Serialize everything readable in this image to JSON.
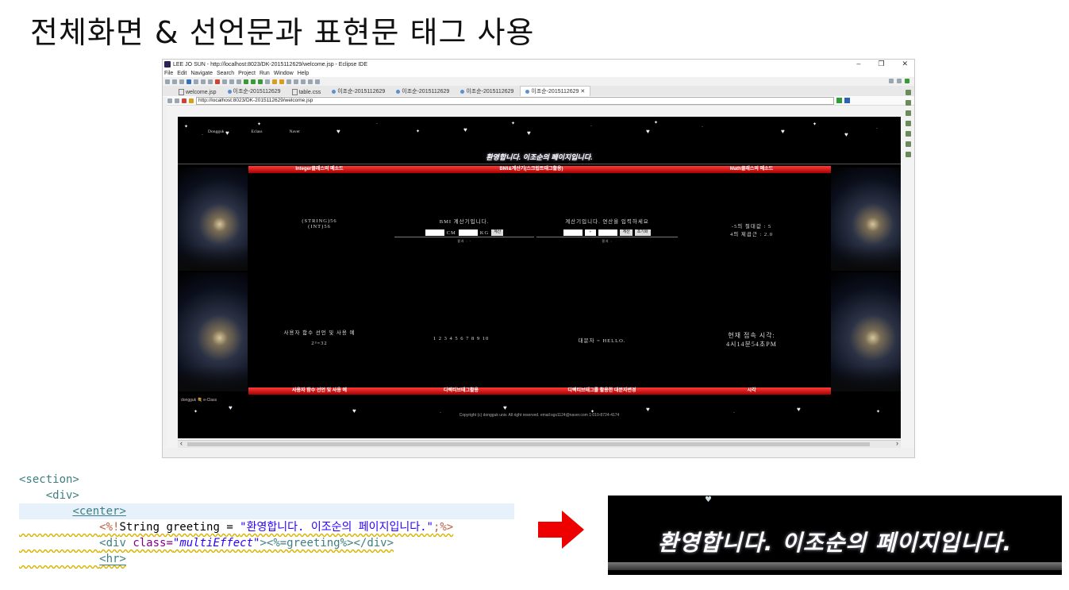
{
  "slide": {
    "title": "전체화면 & 선언문과 표현문 태그 사용"
  },
  "eclipse": {
    "window_title": "LEE JO SUN - http://localhost:8023/DK-2015112629/welcome.jsp - Eclipse IDE",
    "window_controls": {
      "minimize": "–",
      "maximize": "❐",
      "close": "✕"
    },
    "menu": [
      "File",
      "Edit",
      "Navigate",
      "Search",
      "Project",
      "Run",
      "Window",
      "Help"
    ],
    "tabs": [
      {
        "label": "welcome.jsp",
        "icon": "file-icon"
      },
      {
        "label": "이조순-2015112629",
        "icon": "globe-icon"
      },
      {
        "label": "table.css",
        "icon": "file-icon"
      },
      {
        "label": "이조순-2015112629",
        "icon": "globe-icon"
      },
      {
        "label": "이조순-2015112629",
        "icon": "globe-icon"
      },
      {
        "label": "이조순-2015112629",
        "icon": "globe-icon"
      },
      {
        "label": "이조순-2015112629 ✕",
        "icon": "globe-icon",
        "active": true
      }
    ],
    "url": "http://localhost:8023/DK-2015112629/welcome.jsp"
  },
  "page": {
    "nav": [
      "Dongguk",
      "Eclass",
      "Naver"
    ],
    "greeting": "환영합니다. 이조순의 페이지입니다.",
    "headers": [
      "Integer클래스의 메소드",
      "BMI&계산기(스크립트태그활용)",
      "Math클래스의 메소드"
    ],
    "footers": [
      "사용자 함수 선언 및 사용 예",
      "디렉티브태그활용",
      "디렉티브태그를 활용한 대문자변경",
      "시각"
    ],
    "integer_cell": {
      "line1": "(STRING)56",
      "line2": "(INT)56"
    },
    "bmi": {
      "title": "BMI 계산기입니다.",
      "cm": "CM",
      "kg": "KG",
      "button": "계산",
      "result": "결과 : -"
    },
    "calc": {
      "title": "계산기입니다. 연산을 입력하세요",
      "op": "+",
      "button1": "계산",
      "button2": "초기화",
      "result": "결과 :"
    },
    "math_cell": {
      "line1": "-5의 절대값 : 5",
      "line2": "4의 제곱근 : 2.0"
    },
    "func_cell": {
      "line1": "사용자 함수 선언 및 사용 예",
      "line2": "2³=32"
    },
    "numbers": "1 2 3 4 5 6 7 8 9 10",
    "upper": "대문자 = HELLO.",
    "time": {
      "line1": "현재 접속 시각:",
      "line2": "4시14분54초PM"
    },
    "copyright": "Copyright (c) dongguk univ. All right reserved.    email:sgs1124@naver.com 1:010-8724-4174",
    "logo": "dongguk 💐 e-Class"
  },
  "code": {
    "lines": [
      {
        "indent": "",
        "text": "<section>"
      },
      {
        "indent": "    ",
        "text": "<div>"
      },
      {
        "indent": "        ",
        "text": "<center>"
      },
      {
        "indent": "            ",
        "pre": "<%!",
        "kw": "String greeting = ",
        "str": "\"환영합니다. 이조순의 페이지입니다.\"",
        "post": ";%>"
      },
      {
        "indent": "            ",
        "tag": "<div ",
        "attr": "class=",
        "attrv": "\"multiEffect\"",
        "rest": "><%=greeting%></div>"
      },
      {
        "indent": "            ",
        "text": "<hr>"
      }
    ]
  },
  "zoom": {
    "greeting": "환영합니다. 이조순의 페이지입니다."
  },
  "colors": {
    "accent_red": "#e00000",
    "header_red": "#c80000",
    "code_tag": "#3f7f7f"
  }
}
